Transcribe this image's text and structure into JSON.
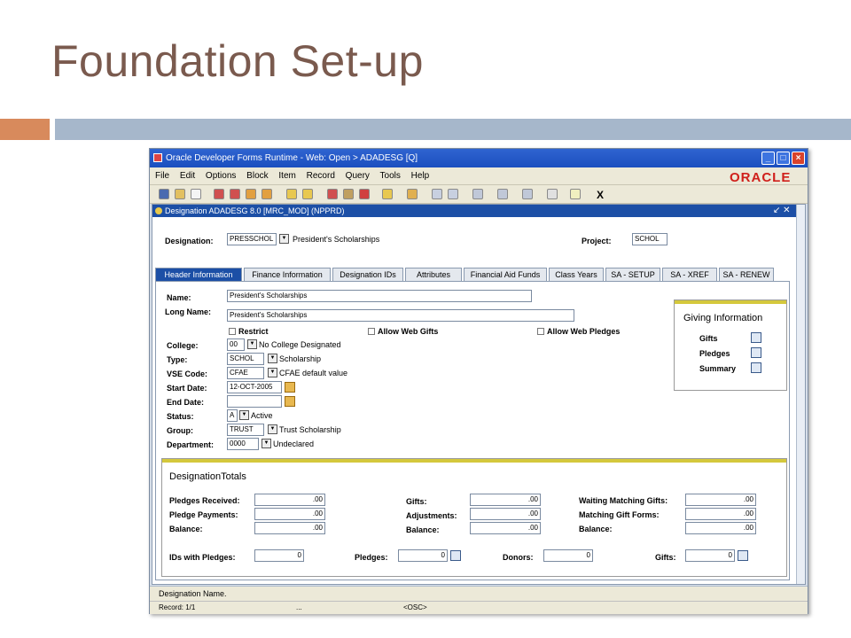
{
  "slide": {
    "title": "Foundation Set-up"
  },
  "window": {
    "title": "Oracle Developer Forms Runtime - Web:  Open > ADADESG [Q]",
    "menu": [
      "File",
      "Edit",
      "Options",
      "Block",
      "Item",
      "Record",
      "Query",
      "Tools",
      "Help"
    ],
    "brand": "ORACLE",
    "toolbar_x": "X"
  },
  "form": {
    "title": "Designation  ADADESG  8.0  [MRC_MOD]  (NPPRD)",
    "controls": "↙ ✕",
    "designation_label": "Designation:",
    "designation_code": "PRESSCHOL",
    "designation_desc": "President's Scholarships",
    "project_label": "Project:",
    "project_value": "SCHOL",
    "tabs": [
      "Header Information",
      "Finance Information",
      "Designation IDs",
      "Attributes",
      "Financial Aid Funds",
      "Class Years",
      "SA - SETUP",
      "SA - XREF",
      "SA - RENEW"
    ],
    "header": {
      "name_label": "Name:",
      "name_value": "President's Scholarships",
      "long_name_label": "Long Name:",
      "long_name_value": "President's Scholarships",
      "restrict_label": "Restrict",
      "allow_web_gifts_label": "Allow Web Gifts",
      "allow_web_pledges_label": "Allow Web Pledges",
      "college_label": "College:",
      "college_code": "00",
      "college_desc": "No College Designated",
      "type_label": "Type:",
      "type_code": "SCHOL",
      "type_desc": "Scholarship",
      "vse_label": "VSE Code:",
      "vse_code": "CFAE",
      "vse_desc": "CFAE default value",
      "start_label": "Start Date:",
      "start_value": "12-OCT-2005",
      "end_label": "End Date:",
      "end_value": "",
      "status_label": "Status:",
      "status_code": "A",
      "status_desc": "Active",
      "group_label": "Group:",
      "group_code": "TRUST",
      "group_desc": "Trust Scholarship",
      "dept_label": "Department:",
      "dept_code": "0000",
      "dept_desc": "Undeclared"
    },
    "giving": {
      "title": "Giving Information",
      "gifts": "Gifts",
      "pledges": "Pledges",
      "summary": "Summary"
    },
    "totals": {
      "title": "DesignationTotals",
      "pledges_received_label": "Pledges Received:",
      "pledges_received": ".00",
      "pledge_payments_label": "Pledge Payments:",
      "pledge_payments": ".00",
      "balance1_label": "Balance:",
      "balance1": ".00",
      "gifts_label": "Gifts:",
      "gifts": ".00",
      "adjustments_label": "Adjustments:",
      "adjustments": ".00",
      "balance2_label": "Balance:",
      "balance2": ".00",
      "waiting_label": "Waiting Matching Gifts:",
      "waiting": ".00",
      "matching_forms_label": "Matching Gift Forms:",
      "matching_forms": ".00",
      "balance3_label": "Balance:",
      "balance3": ".00",
      "ids_pledges_label": "IDs with Pledges:",
      "ids_pledges": "0",
      "pledges_count_label": "Pledges:",
      "pledges_count": "0",
      "donors_label": "Donors:",
      "donors": "0",
      "gifts_count_label": "Gifts:",
      "gifts_count": "0"
    }
  },
  "status": {
    "message": "Designation Name.",
    "record": "Record: 1/1",
    "dots": "...",
    "osc": "<OSC>"
  }
}
